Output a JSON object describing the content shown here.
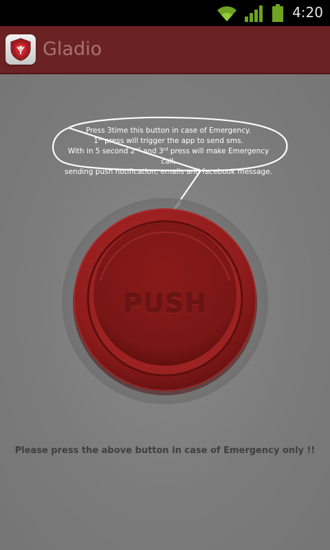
{
  "status_bar": {
    "time": "4:20",
    "icons": [
      "wifi-icon",
      "signal-icon",
      "battery-icon"
    ]
  },
  "action_bar": {
    "app_icon": "gladio-shield-icon",
    "title": "Gladio"
  },
  "instructions": {
    "line1": "Press 3time this button in case of Emergency.",
    "line2_num": "1",
    "line2_sup": "st",
    "line2_text": " press will trigger the app to send sms.",
    "line3_a": "With in 5 second 2",
    "line3_sup1": "nd",
    "line3_b": " and 3",
    "line3_sup2": "rd",
    "line3_c": " press will make Emergency call,",
    "line4": "sending push notification, emails and facebook message."
  },
  "push_button": {
    "label": "PUSH"
  },
  "footer": {
    "note": "Please press the above button in case of Emergency only !!"
  },
  "colors": {
    "action_bar": "#6b2222",
    "background": "#7b7b7b",
    "button_red": "#8e1b1b",
    "status_icon_green": "#6fa322"
  }
}
